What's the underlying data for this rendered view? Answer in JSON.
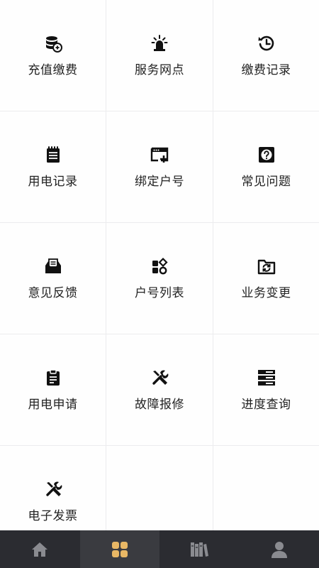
{
  "grid": {
    "items": [
      {
        "label": "充值缴费",
        "icon": "database-coins-icon"
      },
      {
        "label": "服务网点",
        "icon": "siren-beacon-icon"
      },
      {
        "label": "缴费记录",
        "icon": "clock-history-icon"
      },
      {
        "label": "用电记录",
        "icon": "notepad-icon"
      },
      {
        "label": "绑定户号",
        "icon": "window-add-icon"
      },
      {
        "label": "常见问题",
        "icon": "question-box-icon"
      },
      {
        "label": "意见反馈",
        "icon": "mail-tray-icon"
      },
      {
        "label": "户号列表",
        "icon": "apps-grid-icon"
      },
      {
        "label": "业务变更",
        "icon": "folder-sync-icon"
      },
      {
        "label": "用电申请",
        "icon": "clipboard-icon"
      },
      {
        "label": "故障报修",
        "icon": "tools-repair-icon"
      },
      {
        "label": "进度查询",
        "icon": "server-list-icon"
      },
      {
        "label": "电子发票",
        "icon": "tools-repair-icon"
      }
    ]
  },
  "tabbar": {
    "tabs": [
      {
        "name": "home",
        "icon": "home-icon",
        "active": false
      },
      {
        "name": "services",
        "icon": "apps-icon",
        "active": true
      },
      {
        "name": "library",
        "icon": "books-icon",
        "active": false
      },
      {
        "name": "profile",
        "icon": "user-icon",
        "active": false
      }
    ],
    "colors": {
      "background": "#2b2c31",
      "active_icon": "#e8b765",
      "inactive_icon": "#8a8b90"
    }
  }
}
